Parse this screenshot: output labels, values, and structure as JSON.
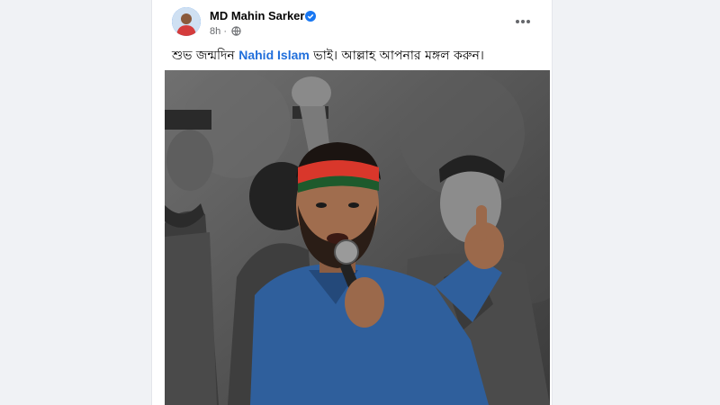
{
  "post": {
    "author": "MD Mahin Sarker",
    "time": "8h",
    "separator": "·",
    "caption": {
      "before": "শুভ জন্মদিন ",
      "mention": "Nahid Islam",
      "after": " ভাই। আল্লাহ আপনার মঙ্গল করুন।"
    }
  },
  "icons": {
    "verified": "verified-badge-icon",
    "audience": "globe-icon",
    "more": "more-options-icon"
  },
  "colors": {
    "verified": "#1877f2",
    "mention": "#216fdb",
    "headband_red": "#d9372b",
    "headband_green": "#1e5a2c",
    "shirt_blue": "#2f5f9c"
  }
}
